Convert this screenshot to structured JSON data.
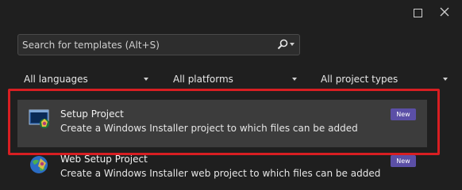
{
  "window": {
    "maximize_icon": "maximize-icon",
    "close_icon": "close-icon"
  },
  "search": {
    "placeholder": "Search for templates (Alt+S)",
    "icon": "search-icon"
  },
  "filters": [
    {
      "label": "All languages"
    },
    {
      "label": "All platforms"
    },
    {
      "label": "All project types"
    }
  ],
  "templates": [
    {
      "title": "Setup Project",
      "description": "Create a Windows Installer project to which files can be added",
      "badge": "New",
      "icon": "setup-project-icon",
      "selected": true
    },
    {
      "title": "Web Setup Project",
      "description": "Create a Windows Installer web project to which files can be added",
      "badge": "New",
      "icon": "web-setup-project-icon",
      "selected": false
    }
  ],
  "colors": {
    "background": "#1f1f1f",
    "selected_row": "#3c3c3c",
    "badge": "#5b4fa6",
    "highlight_border": "#d81e22"
  }
}
